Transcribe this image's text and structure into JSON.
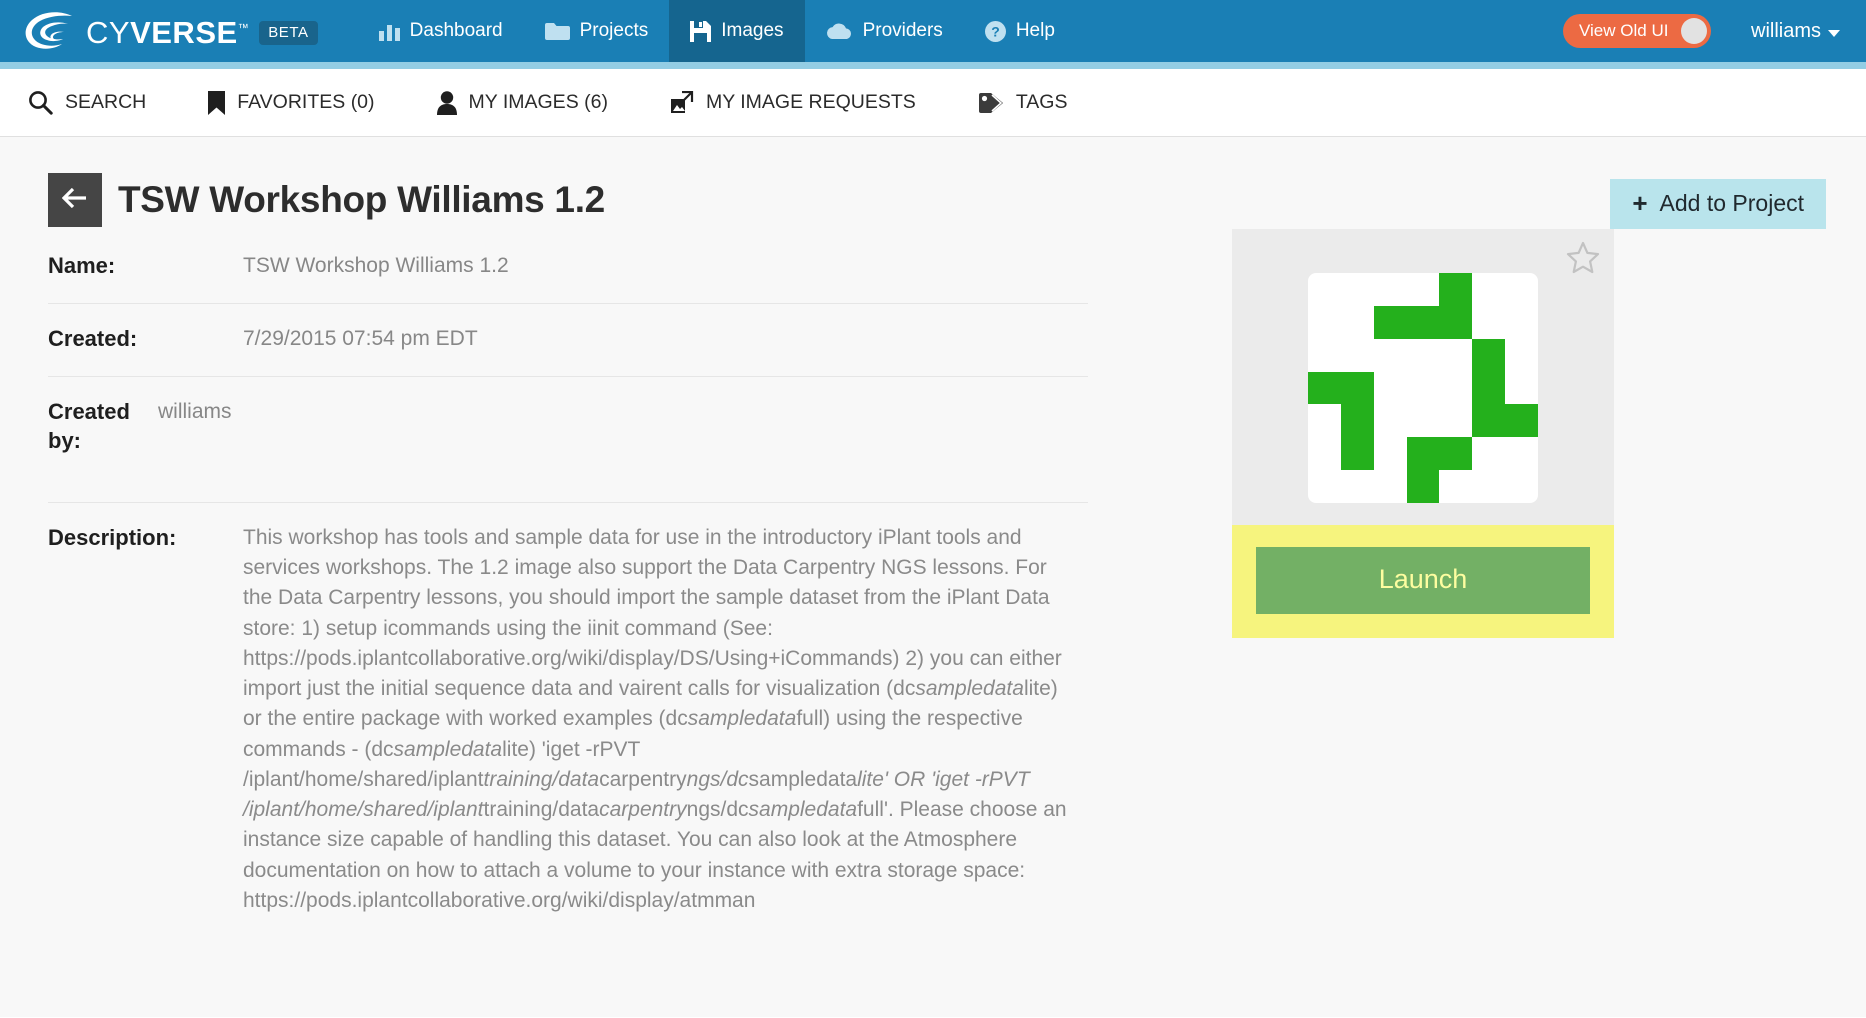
{
  "topnav": {
    "brand": {
      "word_light": "CY",
      "word_bold": "VERSE",
      "tm": "™",
      "beta": "BETA"
    },
    "menu": [
      {
        "label": "Dashboard",
        "icon": "bar-chart-icon",
        "active": false
      },
      {
        "label": "Projects",
        "icon": "folder-icon",
        "active": false
      },
      {
        "label": "Images",
        "icon": "floppy-disk-icon",
        "active": true
      },
      {
        "label": "Providers",
        "icon": "cloud-icon",
        "active": false
      },
      {
        "label": "Help",
        "icon": "question-circle-icon",
        "active": false
      }
    ],
    "old_ui_toggle": {
      "label": "View Old UI",
      "state": "off",
      "color": "#ec6a43"
    },
    "user": {
      "name": "williams",
      "caret": "chevron-down-icon"
    },
    "bg_color": "#1a7fb5",
    "active_bg_color": "#15658f"
  },
  "subnav": {
    "divider_color": "#93cde4",
    "tabs": [
      {
        "label": "SEARCH",
        "icon": "search-icon"
      },
      {
        "label": "FAVORITES (0)",
        "icon": "bookmark-icon"
      },
      {
        "label": "MY IMAGES (6)",
        "icon": "person-icon"
      },
      {
        "label": "MY IMAGE REQUESTS",
        "icon": "image-request-icon"
      },
      {
        "label": "TAGS",
        "icon": "tag-icon"
      }
    ]
  },
  "page": {
    "title": "TSW Workshop Williams 1.2",
    "back_icon": "arrow-left-icon",
    "add_to_project": {
      "label": "Add to Project",
      "plus": "+",
      "bg_color": "#b9e4ec"
    }
  },
  "details": {
    "name": {
      "label": "Name:",
      "value": "TSW Workshop Williams 1.2"
    },
    "created": {
      "label": "Created:",
      "value": "7/29/2015 07:54 pm EDT"
    },
    "created_by": {
      "label": "Created by:",
      "value": "williams"
    },
    "description": {
      "label": "Description:",
      "value": "This workshop has tools and sample data for use in the introductory iPlant tools and services workshops. The 1.2 image also support the Data Carpentry NGS lessons. For the Data Carpentry lessons, you should import the sample dataset from the iPlant Data store: 1) setup icommands using the iinit command (See: https://pods.iplantcollaborative.org/wiki/display/DS/Using+iCommands) 2) you can either import just the initial sequence data and vairent calls for visualization (dc_sampledata_lite) or the entire package with worked examples (dc_sampledata_full) using the respective commands - (dc_sampledata_lite) 'iget -rPVT /iplant/home/shared/iplant_training/data_carpentry_ngs/dc_sampledata_lite' OR 'iget -rPVT /iplant/home/shared/iplant_training/data_carpentry_ngs/dc_sampledata_full'. Please choose an instance size capable of handling this dataset. You can also look at the Atmosphere documentation on how to attach a volume to your instance with extra storage space: https://pods.iplantcollaborative.org/wiki/display/atmman"
    }
  },
  "image_panel": {
    "favorite_icon": "star-outline-icon",
    "favorited": false,
    "identicon": {
      "alt": "image-identicon",
      "fg_color": "#24b01c",
      "bg_color": "#ffffff",
      "grid": [
        [
          0,
          0,
          0,
          0,
          1,
          0,
          0
        ],
        [
          0,
          0,
          1,
          1,
          1,
          0,
          0
        ],
        [
          0,
          0,
          0,
          0,
          0,
          1,
          0
        ],
        [
          1,
          1,
          0,
          0,
          0,
          1,
          0
        ],
        [
          0,
          1,
          0,
          0,
          0,
          1,
          1
        ],
        [
          0,
          1,
          0,
          1,
          1,
          0,
          0
        ],
        [
          0,
          0,
          0,
          1,
          0,
          0,
          0
        ]
      ]
    },
    "card_bg": "#ebebeb",
    "launch": {
      "label": "Launch",
      "band_color": "#f6f47e",
      "button_color": "#73b065",
      "text_color": "#fdfda0"
    }
  }
}
